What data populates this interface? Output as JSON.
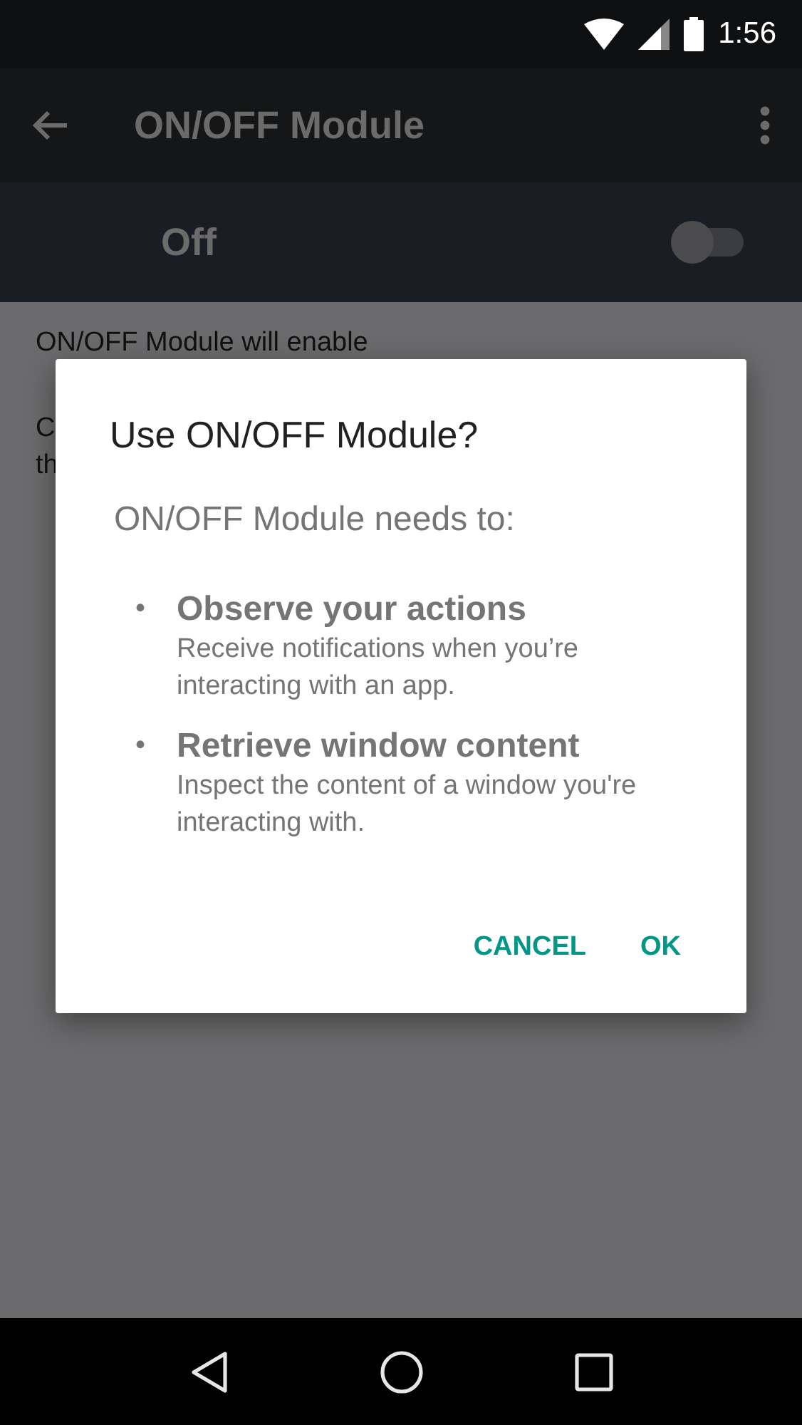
{
  "status_bar": {
    "time": "1:56"
  },
  "toolbar": {
    "title": "ON/OFF Module"
  },
  "master_switch": {
    "label": "Off",
    "on": false
  },
  "description": [
    {
      "text": "ON/OFF Module will enable"
    },
    {
      "text": "C"
    },
    {
      "text": "th"
    }
  ],
  "dialog": {
    "title": "Use ON/OFF Module?",
    "intro": "ON/OFF Module needs to:",
    "permissions": [
      {
        "bullet": "•",
        "title": "Observe your actions",
        "detail": "Receive notifications when you’re interacting with an app."
      },
      {
        "bullet": "•",
        "title": "Retrieve window content",
        "detail": "Inspect the content of a window you're interacting with."
      }
    ],
    "buttons": [
      "CANCEL",
      "OK"
    ]
  }
}
